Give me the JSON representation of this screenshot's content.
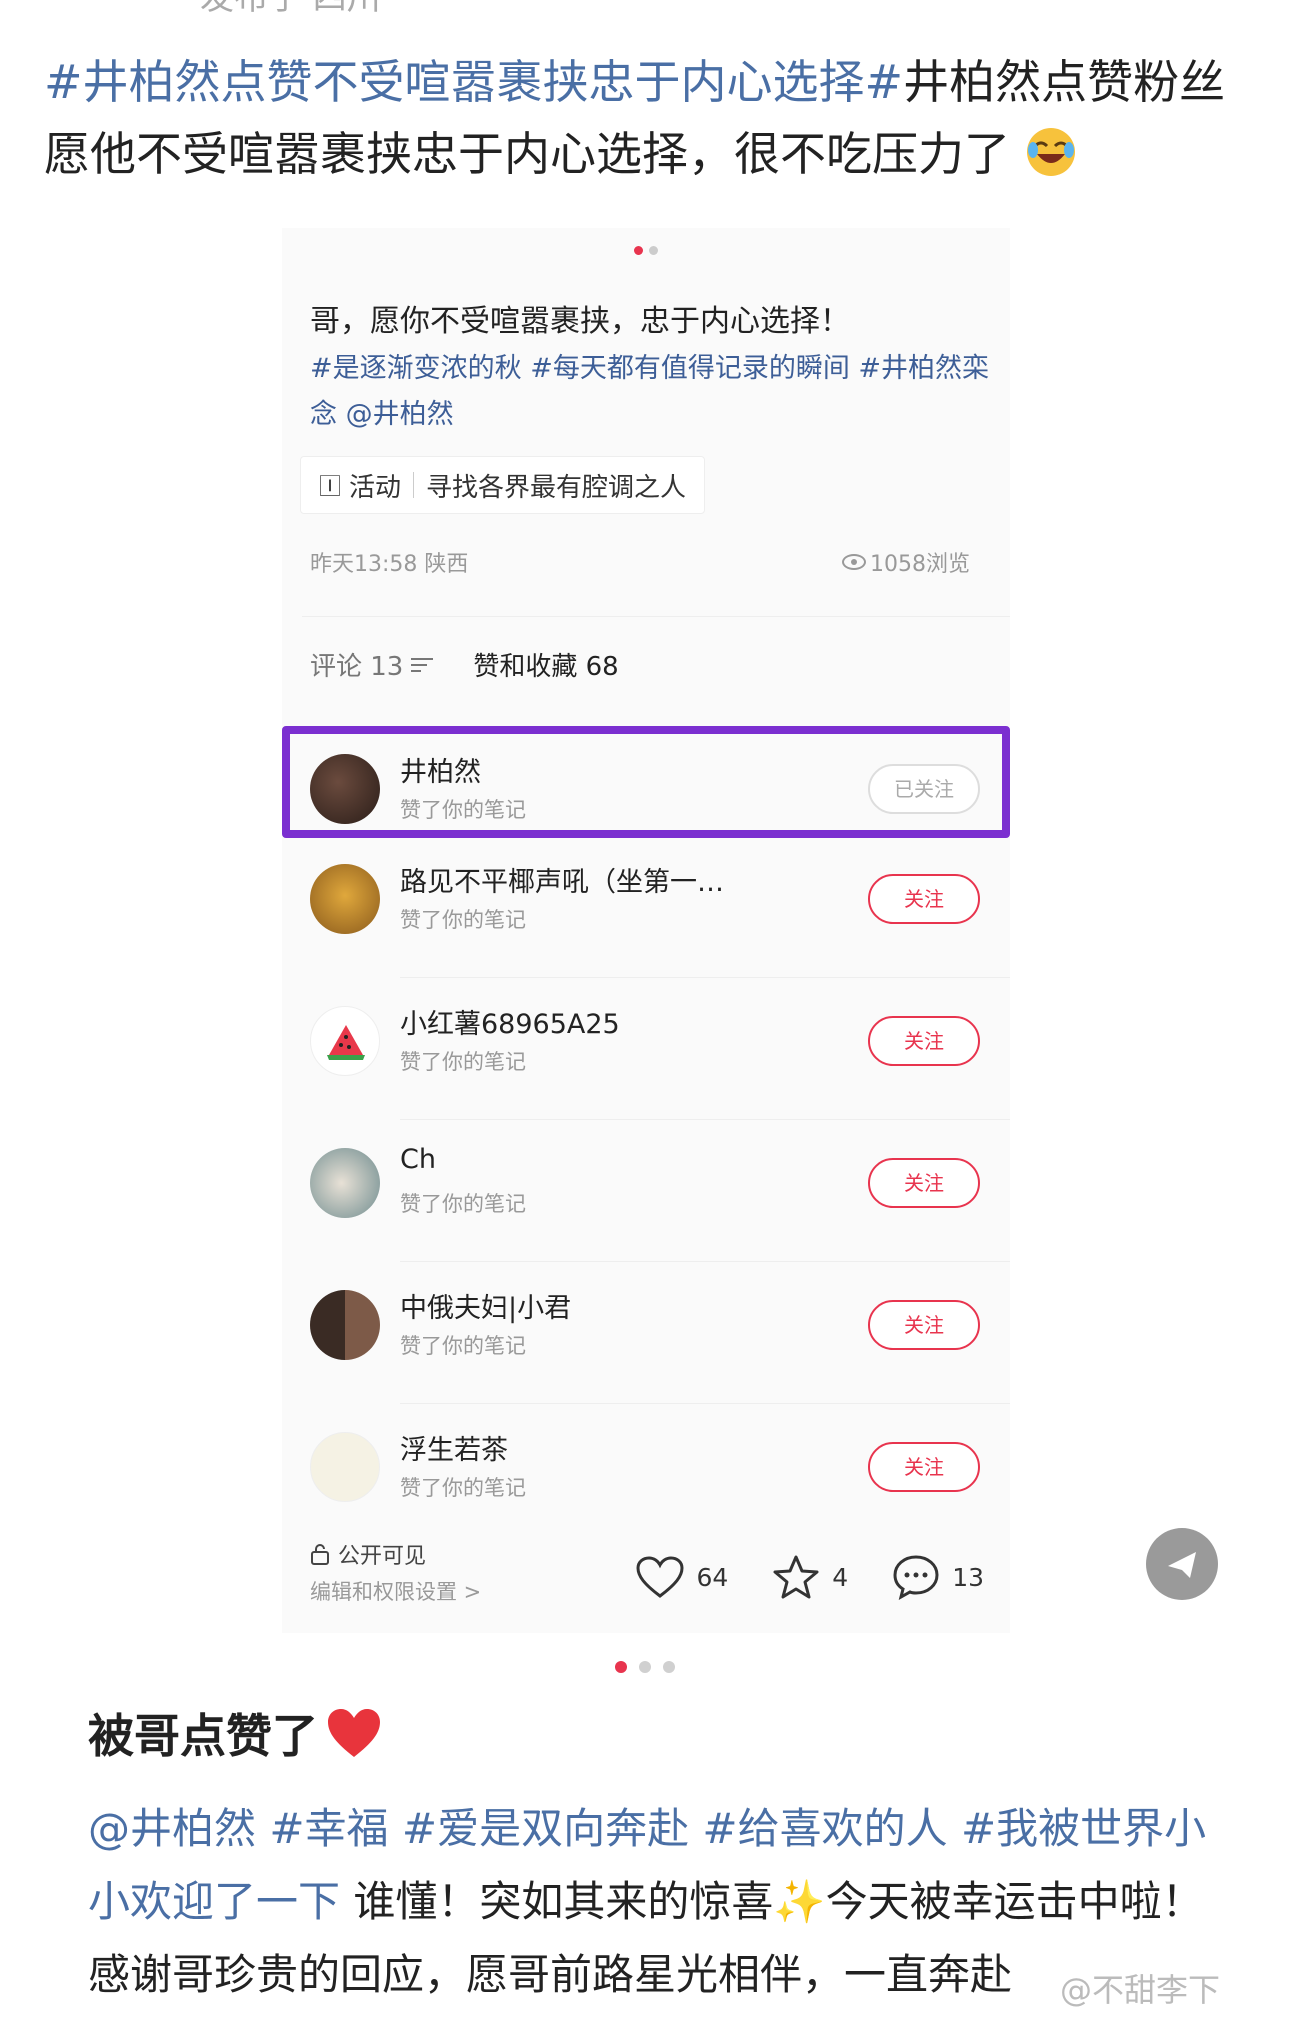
{
  "top_cut_text": "发布于 四川",
  "post": {
    "tag1": "#井柏然点赞不受喧嚣裹挟忠于内心选择#",
    "text": "井柏然点赞粉丝愿他不受喧嚣裹挟忠于内心选择，很不吃压力了"
  },
  "note": {
    "title": "哥，愿你不受喧嚣裹挟，忠于内心选择！",
    "tags": "#是逐渐变浓的秋 #每天都有值得记录的瞬间 #井柏然栾念 @井柏然",
    "activity_icon": "🄸",
    "activity_label": "活动",
    "activity_text": "寻找各界最有腔调之人",
    "time_location": "昨天13:58 陕西",
    "views": "1058浏览",
    "tab_comments": "评论 13",
    "tab_likes": "赞和收藏 68"
  },
  "likers": [
    {
      "name": "井柏然",
      "sub": "赞了你的笔记",
      "button": "已关注",
      "followed": true,
      "avatar_color": "#3b2a24"
    },
    {
      "name": "路见不平椰声吼（坐第一…",
      "sub": "赞了你的笔记",
      "button": "关注",
      "followed": false,
      "avatar_color": "#c88a2a"
    },
    {
      "name": "小红薯68965A25",
      "sub": "赞了你的笔记",
      "button": "关注",
      "followed": false,
      "avatar_color": "#ffffff"
    },
    {
      "name": "Ch",
      "sub": "赞了你的笔记",
      "button": "关注",
      "followed": false,
      "avatar_color": "#8aa2a8"
    },
    {
      "name": "中俄夫妇|小君",
      "sub": "赞了你的笔记",
      "button": "关注",
      "followed": false,
      "avatar_color": "#554438"
    },
    {
      "name": "浮生若茶",
      "sub": "赞了你的笔记",
      "button": "关注",
      "followed": false,
      "avatar_color": "#f3f0dc"
    }
  ],
  "bottom": {
    "privacy": "公开可见",
    "permissions": "编辑和权限设置 >",
    "likes": "64",
    "favorites": "4",
    "comments": "13"
  },
  "caption": {
    "title": "被哥点赞了",
    "tags": "@井柏然 #幸福 #爱是双向奔赴 #给喜欢的人 #我被世界小小欢迎了一下",
    "text1": " 谁懂！突如其来的惊喜",
    "text2": "今天被幸运击中啦！感谢哥珍贵的回应，愿哥前路星光相伴，一直奔赴"
  },
  "watermark": "@不甜李下",
  "colors": {
    "accent_red": "#e8344e",
    "tag_blue": "#4a6fa5",
    "highlight_purple": "#7b2fd0"
  }
}
